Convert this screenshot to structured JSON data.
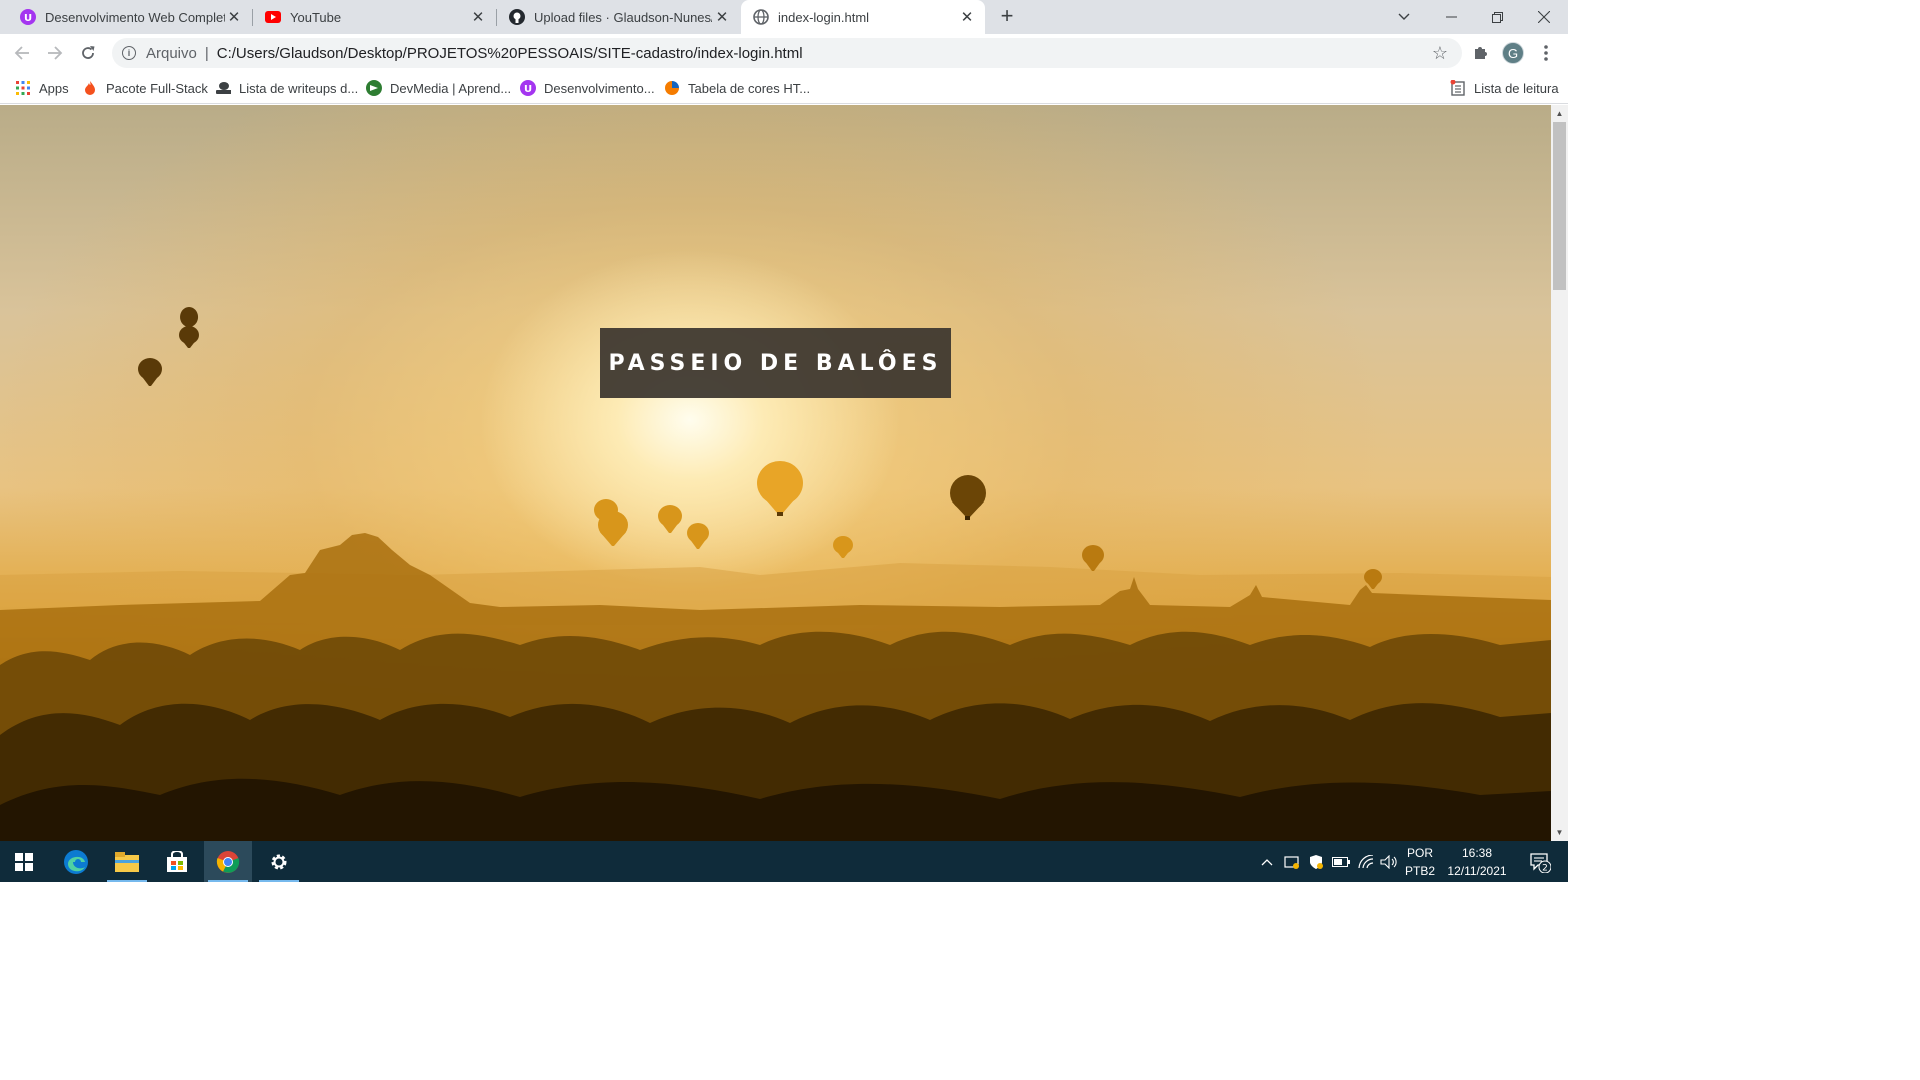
{
  "browser": {
    "tabs": [
      {
        "title": "Desenvolvimento Web Completo",
        "icon": "udemy-icon",
        "active": false
      },
      {
        "title": "YouTube",
        "icon": "youtube-icon",
        "active": false
      },
      {
        "title": "Upload files · Glaudson-Nunes/Tr",
        "icon": "github-icon",
        "active": false
      },
      {
        "title": "index-login.html",
        "icon": "globe-icon",
        "active": true
      }
    ],
    "new_tab_symbol": "+",
    "address_bar": {
      "scheme_label": "Arquivo",
      "divider": "|",
      "url": "C:/Users/Glaudson/Desktop/PROJETOS%20PESSOAIS/SITE-cadastro/index-login.html"
    },
    "profile_initial": "G",
    "bookmarks": [
      {
        "label": "Apps",
        "icon": "apps-grid-icon"
      },
      {
        "label": "Pacote Full-Stack",
        "icon": "flame-icon"
      },
      {
        "label": "Lista de writeups d...",
        "icon": "hacker-icon"
      },
      {
        "label": "DevMedia | Aprend...",
        "icon": "devmedia-icon"
      },
      {
        "label": "Desenvolvimento...",
        "icon": "udemy-icon"
      },
      {
        "label": "Tabela de cores HT...",
        "icon": "color-table-icon"
      }
    ],
    "reading_list_label": "Lista de leitura"
  },
  "page": {
    "hero_title": "PASSEIO DE BALÔES"
  },
  "taskbar": {
    "apps": [
      "start-icon",
      "edge-icon",
      "file-explorer-icon",
      "store-icon",
      "chrome-icon",
      "settings-icon"
    ],
    "language": {
      "line1": "POR",
      "line2": "PTB2"
    },
    "clock": {
      "time": "16:38",
      "date": "12/11/2021"
    },
    "notification_count": "2"
  },
  "colors": {
    "tabstrip": "#dee1e6",
    "taskbar": "#0f2b3a",
    "hero_box": "#3e3730",
    "sky_gold": "#e2aa45"
  }
}
